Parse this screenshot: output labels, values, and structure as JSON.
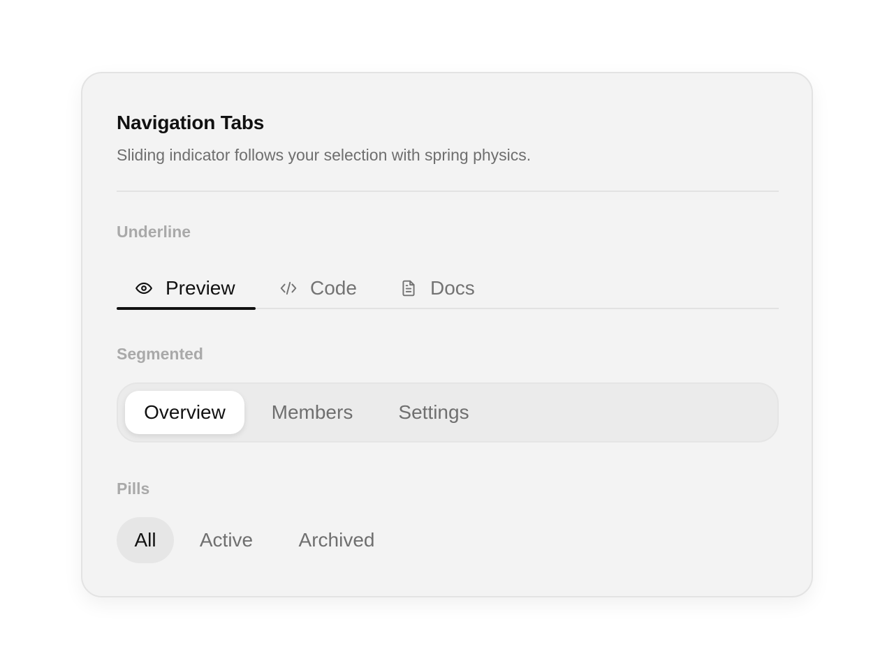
{
  "header": {
    "title": "Navigation Tabs",
    "subtitle": "Sliding indicator follows your selection with spring physics."
  },
  "underline": {
    "label": "Underline",
    "tabs": [
      {
        "label": "Preview",
        "icon": "eye-icon",
        "active": true
      },
      {
        "label": "Code",
        "icon": "code-icon",
        "active": false
      },
      {
        "label": "Docs",
        "icon": "document-icon",
        "active": false
      }
    ]
  },
  "segmented": {
    "label": "Segmented",
    "tabs": [
      {
        "label": "Overview",
        "active": true
      },
      {
        "label": "Members",
        "active": false
      },
      {
        "label": "Settings",
        "active": false
      }
    ]
  },
  "pills": {
    "label": "Pills",
    "tabs": [
      {
        "label": "All",
        "active": true
      },
      {
        "label": "Active",
        "active": false
      },
      {
        "label": "Archived",
        "active": false
      }
    ]
  },
  "colors": {
    "card_background": "#f3f3f3",
    "active_text": "#111111",
    "inactive_text": "#737373",
    "section_label": "#a9a9a9",
    "indicator": "#111111"
  }
}
